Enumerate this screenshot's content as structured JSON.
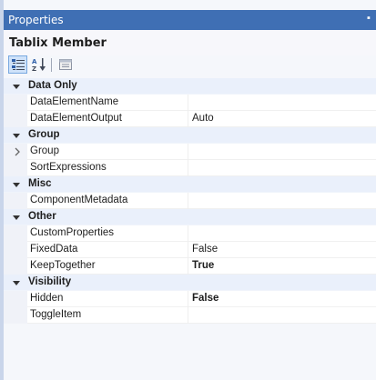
{
  "window": {
    "title": "Properties"
  },
  "header": {
    "title": "Tablix Member"
  },
  "toolbar": {
    "buttons": [
      {
        "name": "categorized-view-button",
        "icon": "categorized-icon",
        "active": true
      },
      {
        "name": "alphabetical-view-button",
        "icon": "sort-az-icon",
        "active": false
      },
      {
        "name": "property-pages-button",
        "icon": "property-pages-icon",
        "active": false
      }
    ]
  },
  "colors": {
    "titlebar": "#3f6fb4",
    "category_bg": "#eaf0fb",
    "selected_button": "#cfe2f9"
  },
  "categories": [
    {
      "label": "Data Only",
      "properties": [
        {
          "name": "DataElementName",
          "value": "",
          "bold": false,
          "expandable": false
        },
        {
          "name": "DataElementOutput",
          "value": "Auto",
          "bold": false,
          "expandable": false
        }
      ]
    },
    {
      "label": "Group",
      "properties": [
        {
          "name": "Group",
          "value": "",
          "bold": false,
          "expandable": true
        },
        {
          "name": "SortExpressions",
          "value": "",
          "bold": false,
          "expandable": false
        }
      ]
    },
    {
      "label": "Misc",
      "properties": [
        {
          "name": "ComponentMetadata",
          "value": "",
          "bold": false,
          "expandable": false
        }
      ]
    },
    {
      "label": "Other",
      "properties": [
        {
          "name": "CustomProperties",
          "value": "",
          "bold": false,
          "expandable": false
        },
        {
          "name": "FixedData",
          "value": "False",
          "bold": false,
          "expandable": false
        },
        {
          "name": "KeepTogether",
          "value": "True",
          "bold": true,
          "expandable": false
        }
      ]
    },
    {
      "label": "Visibility",
      "properties": [
        {
          "name": "Hidden",
          "value": "False",
          "bold": true,
          "expandable": false
        },
        {
          "name": "ToggleItem",
          "value": "",
          "bold": false,
          "expandable": false
        }
      ]
    }
  ]
}
